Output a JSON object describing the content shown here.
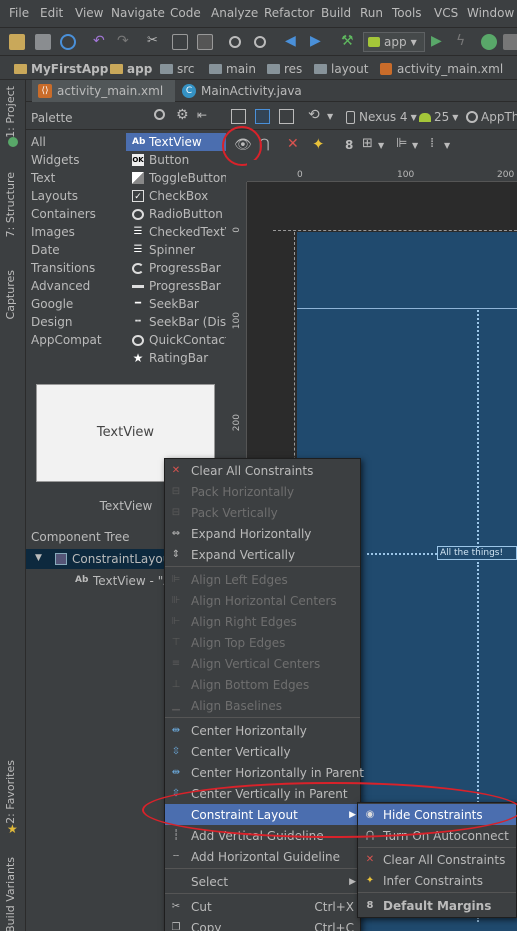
{
  "menubar": {
    "items": [
      "File",
      "Edit",
      "View",
      "Navigate",
      "Code",
      "Analyze",
      "Refactor",
      "Build",
      "Run",
      "Tools",
      "VCS",
      "Window"
    ]
  },
  "toolbar": {
    "run_config": "app"
  },
  "breadcrumb": [
    "MyFirstApp",
    "app",
    "src",
    "main",
    "res",
    "layout",
    "activity_main.xml"
  ],
  "file_tabs": [
    {
      "label": "activity_main.xml",
      "icon": "xml-file-icon"
    },
    {
      "label": "MainActivity.java",
      "icon": "java-class-icon"
    }
  ],
  "left_strip": {
    "project": "1: Project",
    "structure": "7: Structure",
    "captures": "Captures",
    "favorites": "2: Favorites",
    "build_variants": "Build Variants"
  },
  "palette": {
    "title": "Palette",
    "categories": [
      "All",
      "Widgets",
      "Text",
      "Layouts",
      "Containers",
      "Images",
      "Date",
      "Transitions",
      "Advanced",
      "Google",
      "Design",
      "AppCompat"
    ],
    "widgets": [
      {
        "label": "TextView",
        "icon": "Ab"
      },
      {
        "label": "Button",
        "icon": "OK"
      },
      {
        "label": "ToggleButton",
        "icon": "toggle-icon"
      },
      {
        "label": "CheckBox",
        "icon": "checkbox-icon"
      },
      {
        "label": "RadioButton",
        "icon": "radio-icon"
      },
      {
        "label": "CheckedTextView",
        "icon": "checked-text-icon"
      },
      {
        "label": "Spinner",
        "icon": "spinner-icon"
      },
      {
        "label": "ProgressBar",
        "icon": "progress-circle-icon"
      },
      {
        "label": "ProgressBar",
        "icon": "progress-bar-icon"
      },
      {
        "label": "SeekBar",
        "icon": "seekbar-icon"
      },
      {
        "label": "SeekBar (Discrete)",
        "icon": "seekbar-icon"
      },
      {
        "label": "QuickContactBadge",
        "icon": "contact-icon"
      },
      {
        "label": "RatingBar",
        "icon": "star-icon"
      }
    ],
    "preview_text": "TextView",
    "preview_caption": "TextView"
  },
  "component_tree": {
    "title": "Component Tree",
    "root": "ConstraintLayout",
    "child": "TextView - \"A"
  },
  "designer": {
    "device": "Nexus 4",
    "api": "25",
    "theme": "AppThe",
    "margin_value": "8",
    "ruler_top": [
      "0",
      "100",
      "200"
    ],
    "ruler_left": [
      "0",
      "100",
      "200"
    ],
    "textview_text": "All the things!"
  },
  "context_menu": {
    "items": [
      {
        "label": "Clear All Constraints",
        "icon": "clear-constraints-icon",
        "enabled": true
      },
      {
        "label": "Pack Horizontally",
        "icon": "pack-horizontal-icon",
        "enabled": false
      },
      {
        "label": "Pack Vertically",
        "icon": "pack-vertical-icon",
        "enabled": false
      },
      {
        "label": "Expand Horizontally",
        "icon": "expand-horizontal-icon",
        "enabled": true
      },
      {
        "label": "Expand Vertically",
        "icon": "expand-vertical-icon",
        "enabled": true
      },
      {
        "label": "Align Left Edges",
        "icon": "align-left-icon",
        "enabled": false
      },
      {
        "label": "Align Horizontal Centers",
        "icon": "align-hcenter-icon",
        "enabled": false
      },
      {
        "label": "Align Right Edges",
        "icon": "align-right-icon",
        "enabled": false
      },
      {
        "label": "Align Top Edges",
        "icon": "align-top-icon",
        "enabled": false
      },
      {
        "label": "Align Vertical Centers",
        "icon": "align-vcenter-icon",
        "enabled": false
      },
      {
        "label": "Align Bottom Edges",
        "icon": "align-bottom-icon",
        "enabled": false
      },
      {
        "label": "Align Baselines",
        "icon": "align-baseline-icon",
        "enabled": false
      },
      {
        "label": "Center Horizontally",
        "icon": "center-horizontal-icon",
        "enabled": true
      },
      {
        "label": "Center Vertically",
        "icon": "center-vertical-icon",
        "enabled": true
      },
      {
        "label": "Center Horizontally in Parent",
        "icon": "center-h-parent-icon",
        "enabled": true
      },
      {
        "label": "Center Vertically in Parent",
        "icon": "center-v-parent-icon",
        "enabled": true
      },
      {
        "label": "Constraint Layout",
        "icon": "",
        "enabled": true,
        "submenu": true
      },
      {
        "label": "Add Vertical Guideline",
        "icon": "vertical-guideline-icon",
        "enabled": true
      },
      {
        "label": "Add Horizontal Guideline",
        "icon": "horizontal-guideline-icon",
        "enabled": true
      },
      {
        "label": "Select",
        "icon": "",
        "enabled": true,
        "submenu": true
      },
      {
        "label": "Cut",
        "icon": "cut-icon",
        "enabled": true,
        "shortcut": "Ctrl+X"
      },
      {
        "label": "Copy",
        "icon": "copy-icon",
        "enabled": true,
        "shortcut": "Ctrl+C"
      }
    ]
  },
  "submenu": {
    "items": [
      {
        "label": "Hide Constraints",
        "icon": "eye-icon"
      },
      {
        "label": "Turn On Autoconnect",
        "icon": "magnet-icon"
      },
      {
        "label": "Clear All Constraints",
        "icon": "clear-constraints-icon"
      },
      {
        "label": "Infer Constraints",
        "icon": "infer-constraints-icon"
      },
      {
        "label": "Default Margins",
        "icon": "8"
      }
    ]
  },
  "colors": {
    "background": "#3c3f41",
    "selection": "#4b6eaf",
    "blueprint": "#204a6e",
    "annotation_red": "#d9222a"
  }
}
